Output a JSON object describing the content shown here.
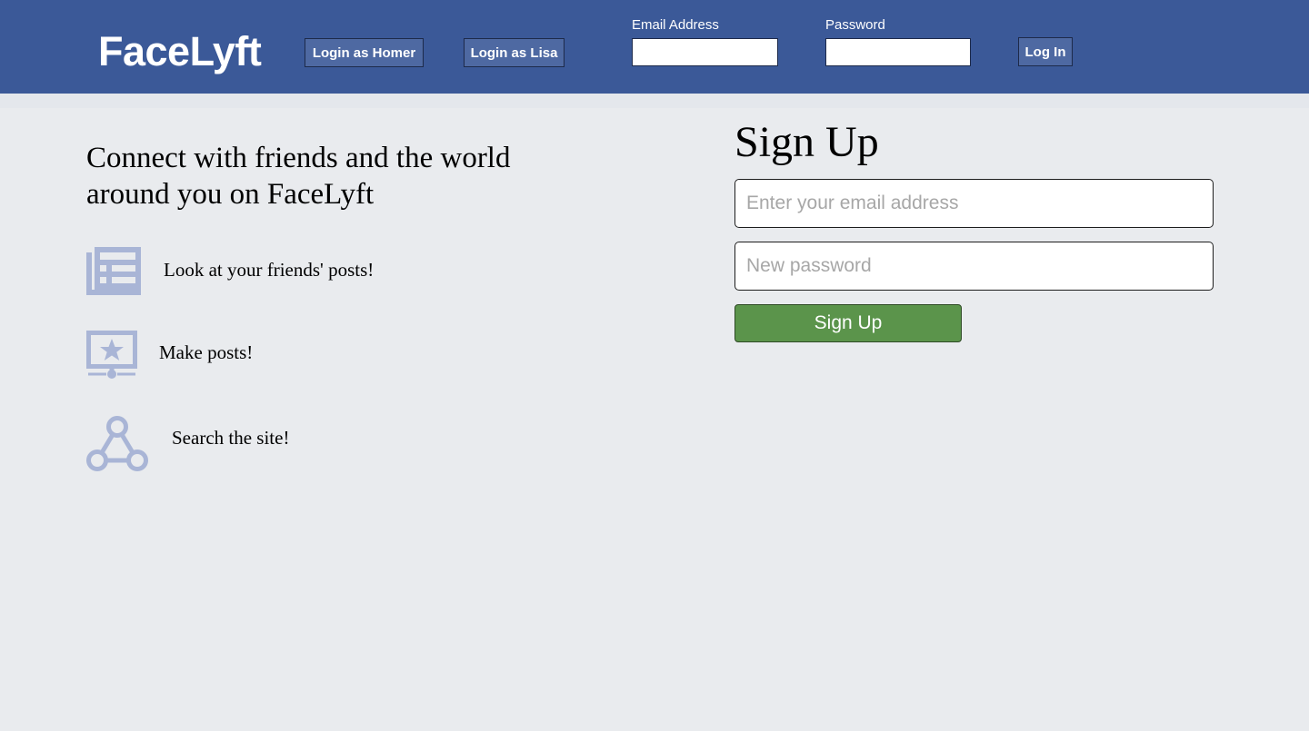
{
  "colors": {
    "header_bg": "#3b5998",
    "page_bg": "#e9ebee",
    "header_button_bg": "#4e69a2",
    "signup_button_bg": "#5b944b",
    "icon_color": "#a9b5d6"
  },
  "header": {
    "logo": "FaceLyft",
    "demo_login_homer": "Login as Homer",
    "demo_login_lisa": "Login as Lisa",
    "email_label": "Email Address",
    "email_value": "",
    "password_label": "Password",
    "password_value": "",
    "login_button": "Log In"
  },
  "intro": {
    "tagline": "Connect with friends and the world around you on FaceLyft",
    "features": [
      {
        "icon": "newsfeed-icon",
        "text": "Look at your friends' posts!"
      },
      {
        "icon": "presentation-star-icon",
        "text": "Make posts!"
      },
      {
        "icon": "network-icon",
        "text": "Search the site!"
      }
    ]
  },
  "signup": {
    "title": "Sign Up",
    "email_placeholder": "Enter your email address",
    "password_placeholder": "New password",
    "button": "Sign Up"
  }
}
